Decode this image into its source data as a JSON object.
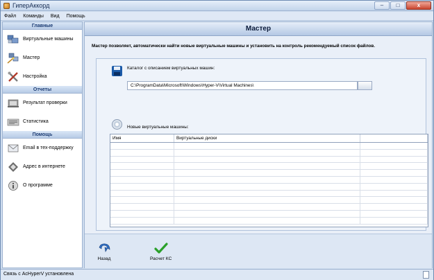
{
  "window": {
    "title": "ГиперАккорд",
    "minimize": "–",
    "maximize": "□",
    "close": "x"
  },
  "menu": [
    "Файл",
    "Команды",
    "Вид",
    "Помощь"
  ],
  "sidebar": {
    "groups": [
      {
        "title": "Главные",
        "items": [
          {
            "label": "Виртуальные машины",
            "icon": "virtual-machines-icon"
          },
          {
            "label": "Мастер",
            "icon": "wizard-icon"
          },
          {
            "label": "Настройка",
            "icon": "settings-tools-icon"
          }
        ]
      },
      {
        "title": "Отчеты",
        "items": [
          {
            "label": "Результат проверки",
            "icon": "check-results-icon"
          },
          {
            "label": "Статистика",
            "icon": "statistics-icon"
          }
        ]
      },
      {
        "title": "Помощь",
        "items": [
          {
            "label": "Email в тех-поддержку",
            "icon": "email-icon"
          },
          {
            "label": "Адрес в интернете",
            "icon": "web-address-icon"
          },
          {
            "label": "О программе",
            "icon": "about-icon"
          }
        ]
      }
    ]
  },
  "main": {
    "header": "Мастер",
    "intro": "Мастер позволяет, автоматически найти новые виртуальные машины и установить на контроль рекомендуемый список файлов.",
    "catalog_label": "Каталог с описанием виртуальных машин:",
    "catalog_path": "C:\\ProgramData\\Microsoft\\Windows\\Hyper-V\\Virtual Machines\\",
    "vm_label": "Новые виртуальные машины:",
    "table": {
      "columns": [
        "Имя",
        "Виртуальные диски",
        ""
      ],
      "rows": 12
    },
    "actions": {
      "back": "Назад",
      "compute": "Расчет КС"
    }
  },
  "status": {
    "text": "Связь с AcHyperV установлена"
  },
  "colors": {
    "accent": "#1b5aa8",
    "check": "#2aa02a",
    "header_text": "#1a3a72"
  }
}
